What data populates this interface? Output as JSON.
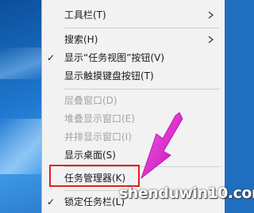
{
  "context_menu": {
    "items": [
      {
        "label": "工具栏(T)",
        "checked": false,
        "submenu": true,
        "disabled": false
      },
      {
        "label": "搜索(H)",
        "checked": false,
        "submenu": true,
        "disabled": false
      },
      {
        "label": "显示“任务视图”按钮(V)",
        "checked": true,
        "submenu": false,
        "disabled": false
      },
      {
        "label": "显示触摸键盘按钮(T)",
        "checked": false,
        "submenu": false,
        "disabled": false
      },
      {
        "label": "层叠窗口(D)",
        "checked": false,
        "submenu": false,
        "disabled": true
      },
      {
        "label": "堆叠显示窗口(E)",
        "checked": false,
        "submenu": false,
        "disabled": true
      },
      {
        "label": "并排显示窗口(I)",
        "checked": false,
        "submenu": false,
        "disabled": true
      },
      {
        "label": "显示桌面(S)",
        "checked": false,
        "submenu": false,
        "disabled": false
      },
      {
        "label": "任务管理器(K)",
        "checked": false,
        "submenu": false,
        "disabled": false
      },
      {
        "label": "锁定任务栏(L)",
        "checked": true,
        "submenu": false,
        "disabled": false
      }
    ],
    "check_mark": "✓"
  },
  "annotation": {
    "highlight_color": "#e0201b",
    "arrow_color": "#e61fd6"
  },
  "watermark": {
    "text": "shenduwin10.com"
  }
}
